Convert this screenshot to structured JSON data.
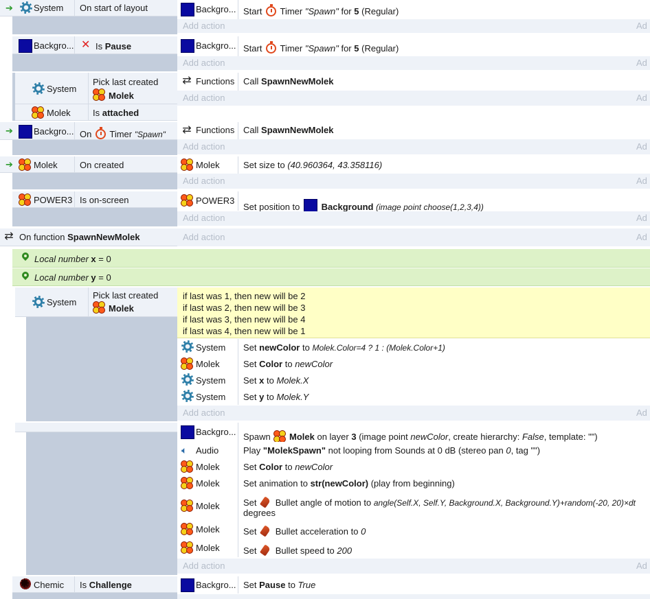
{
  "add_action_label": "Add action",
  "add_cut_label": "Ad",
  "icons": {
    "system": "gear-icon",
    "background": "background-sprite-icon",
    "molek": "molek-sprite-icon",
    "functions": "functions-icon",
    "timer": "timer-icon",
    "audio": "audio-icon",
    "bullet": "bullet-behavior-icon",
    "local": "local-variable-icon",
    "chemic": "chemic-sprite-icon",
    "trigger": "trigger-arrow-icon",
    "invert": "invert-x-icon"
  },
  "events": {
    "e1": {
      "cond_obj": "System",
      "cond_text": "On start of layout",
      "act_obj": "Backgro...",
      "act_start": "Start",
      "act_timer": "Timer",
      "act_tag": "\"Spawn\"",
      "act_for": "for",
      "act_num": "5",
      "act_mode": "(Regular)"
    },
    "e2": {
      "cond_obj": "Backgro...",
      "cond_is": "Is",
      "cond_bold": "Pause",
      "act_obj": "Backgro...",
      "act_start": "Start",
      "act_timer": "Timer",
      "act_tag": "\"Spawn\"",
      "act_for": "for",
      "act_num": "5",
      "act_mode": "(Regular)"
    },
    "e3": {
      "cond1_obj": "System",
      "cond1_l1": "Pick last created",
      "cond1_l2": "Molek",
      "cond2_obj": "Molek",
      "cond2_is": "Is",
      "cond2_bold": "attached",
      "act_obj": "Functions",
      "act_call": "Call",
      "act_fn": "SpawnNewMolek"
    },
    "e4": {
      "cond_obj": "Backgro...",
      "cond_on": "On",
      "cond_timer": "Timer",
      "cond_tag": "\"Spawn\"",
      "act_obj": "Functions",
      "act_call": "Call",
      "act_fn": "SpawnNewMolek"
    },
    "e5": {
      "cond_obj": "Molek",
      "cond_text": "On created",
      "act_obj": "Molek",
      "act_text": "Set size to",
      "act_val": "(40.960364, 43.358116)"
    },
    "e6": {
      "cond_obj": "POWER3",
      "cond_text": "Is on-screen",
      "act_obj": "POWER3",
      "act_text": "Set position to",
      "act_target": "Background",
      "act_expr": "(image point choose(1,2,3,4))"
    },
    "fn": {
      "label": "On function",
      "name": "SpawnNewMolek"
    },
    "local_x": {
      "label": "Local number",
      "var": "x",
      "val": "= 0"
    },
    "local_y": {
      "label": "Local number",
      "var": "y",
      "val": "= 0"
    },
    "sub1": {
      "cond_obj": "System",
      "cond_l1": "Pick last created",
      "cond_l2": "Molek",
      "comment": [
        "if last was 1, then new will be 2",
        "if last was 2, then new will be 3",
        "if last was 3, then new will be 4",
        "if last was 4, then new will be 1"
      ],
      "a1_obj": "System",
      "a1_set": "Set",
      "a1_var": "newColor",
      "a1_to": "to",
      "a1_expr": "Molek.Color=4 ? 1 : (Molek.Color+1)",
      "a2_obj": "Molek",
      "a2_set": "Set",
      "a2_var": "Color",
      "a2_to": "to",
      "a2_expr": "newColor",
      "a3_obj": "System",
      "a3_set": "Set",
      "a3_var": "x",
      "a3_to": "to",
      "a3_expr": "Molek.X",
      "a4_obj": "System",
      "a4_set": "Set",
      "a4_var": "y",
      "a4_to": "to",
      "a4_expr": "Molek.Y"
    },
    "sub2": {
      "a1_obj": "Backgro...",
      "a1_spawn": "Spawn",
      "a1_what": "Molek",
      "a1_layer": "on layer",
      "a1_layer_num": "3",
      "a1_rest1": "(image point",
      "a1_pt": "newColor",
      "a1_rest2": ", create hierarchy:",
      "a1_false": "False",
      "a1_rest3": ", template: \"\")",
      "a2_obj": "Audio",
      "a2_play": "Play",
      "a2_sound": "\"MolekSpawn\"",
      "a2_rest": "not looping from Sounds at 0 dB (stereo pan",
      "a2_pan": "0",
      "a2_rest2": ", tag \"\")",
      "a3_obj": "Molek",
      "a3_set": "Set",
      "a3_var": "Color",
      "a3_to": "to",
      "a3_expr": "newColor",
      "a4_obj": "Molek",
      "a4_text": "Set animation to",
      "a4_bold": "str(newColor)",
      "a4_rest": "(play from beginning)",
      "a5_obj": "Molek",
      "a5_set": "Set",
      "a5_text": "Bullet angle of motion to",
      "a5_expr": "angle(Self.X, Self.Y, Background.X, Background.Y)+random(-20, 20)×dt",
      "a5_l2": "degrees",
      "a6_obj": "Molek",
      "a6_set": "Set",
      "a6_text": "Bullet acceleration to",
      "a6_expr": "0",
      "a7_obj": "Molek",
      "a7_set": "Set",
      "a7_text": "Bullet speed to",
      "a7_expr": "200"
    },
    "e8": {
      "cond_obj": "Chemic",
      "cond_is": "Is",
      "cond_bold": "Challenge",
      "act_obj": "Backgro...",
      "act_set": "Set",
      "act_var": "Pause",
      "act_to": "to",
      "act_expr": "True"
    }
  }
}
